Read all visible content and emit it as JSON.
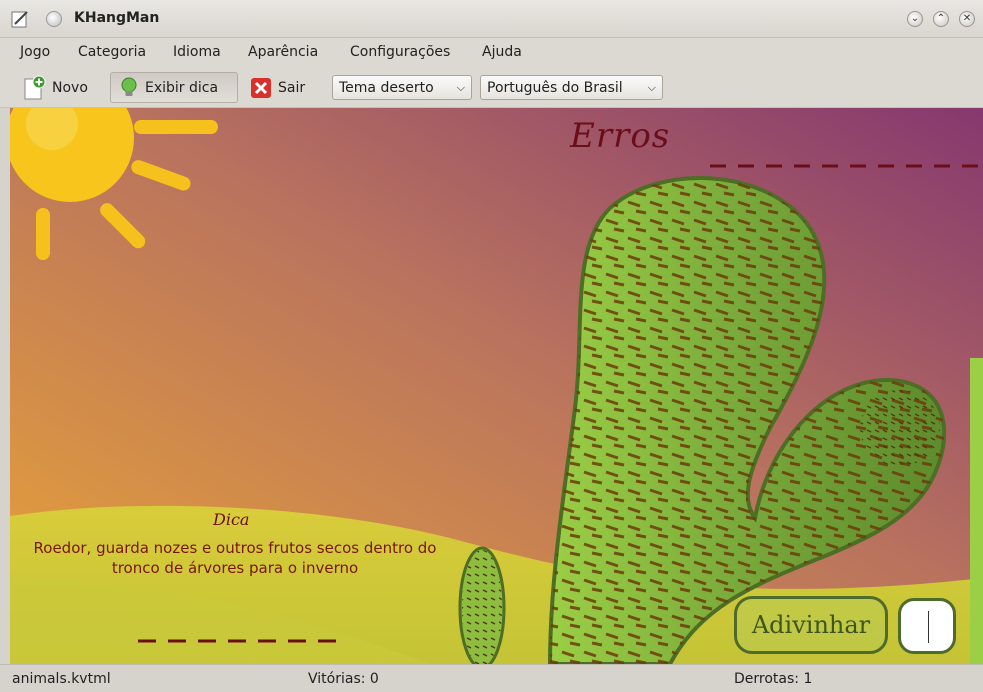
{
  "window": {
    "title": "KHangMan"
  },
  "menubar": {
    "items": [
      "Jogo",
      "Categoria",
      "Idioma",
      "Aparência",
      "Configurações",
      "Ajuda"
    ]
  },
  "toolbar": {
    "new_label": "Novo",
    "hint_label": "Exibir dica",
    "quit_label": "Sair",
    "theme_value": "Tema deserto",
    "language_value": "Português do Brasil"
  },
  "game": {
    "errors_label": "Erros",
    "hint_title": "Dica",
    "hint_text": "Roedor, guarda nozes e outros frutos secos dentro do tronco de árvores para o inverno",
    "word_mask": "_ _ _ _ _ _ _",
    "guess_button": "Adivinhar",
    "guess_value": ""
  },
  "statusbar": {
    "file": "animals.kvtml",
    "wins": "Vitórias: 0",
    "losses": "Derrotas: 1"
  },
  "colors": {
    "sky_top": "#8b3f6e",
    "sky_bottom": "#e9a83a",
    "sun": "#f6c11c",
    "cactus": "#7ea73a",
    "text_red": "#7a1515"
  }
}
